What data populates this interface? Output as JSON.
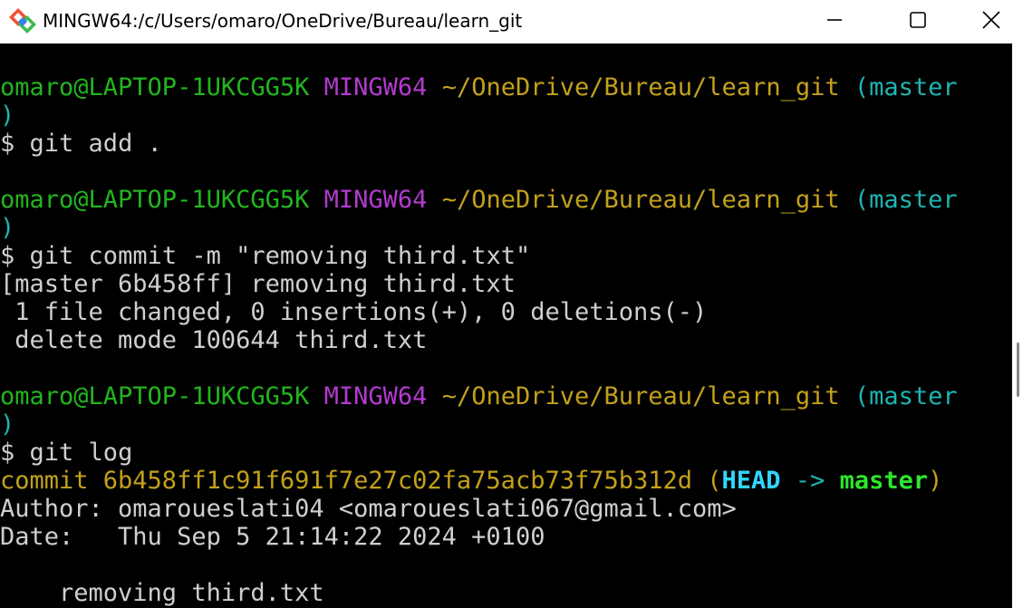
{
  "window": {
    "title": "MINGW64:/c/Users/omaro/OneDrive/Bureau/learn_git"
  },
  "prompt": {
    "user_host": "omaro@LAPTOP-1UKCGG5K",
    "shell": "MINGW64",
    "path": "~/OneDrive/Bureau/learn_git",
    "branch_open": "(master",
    "branch_close": ")",
    "symbol": "$"
  },
  "commands": [
    "git add .",
    "git commit -m \"removing third.txt\"",
    "git log"
  ],
  "commit_output": [
    "[master 6b458ff] removing third.txt",
    " 1 file changed, 0 insertions(+), 0 deletions(-)",
    " delete mode 100644 third.txt"
  ],
  "log": {
    "commit_prefix": "commit 6b458ff1c91f691f7e27c02fa75acb73f75b312d (",
    "head": "HEAD",
    "arrow": " -> ",
    "branch": "master",
    "commit_suffix": ")",
    "author": "Author: omaroueslati04 <omaroueslati067@gmail.com>",
    "date": "Date:   Thu Sep 5 21:14:22 2024 +0100",
    "message": "    removing third.txt"
  },
  "colors": {
    "user_host": "#22b51e",
    "shell": "#b33bd0",
    "path": "#c3a11b",
    "branch": "#1db5b3",
    "text": "#cfcfcf",
    "head": "#32d6ff",
    "log_branch": "#2ee62e",
    "background": "#000000"
  },
  "icons": {
    "app": "git-bash-icon",
    "minimize": "minimize-icon",
    "maximize": "maximize-icon",
    "close": "close-icon"
  }
}
